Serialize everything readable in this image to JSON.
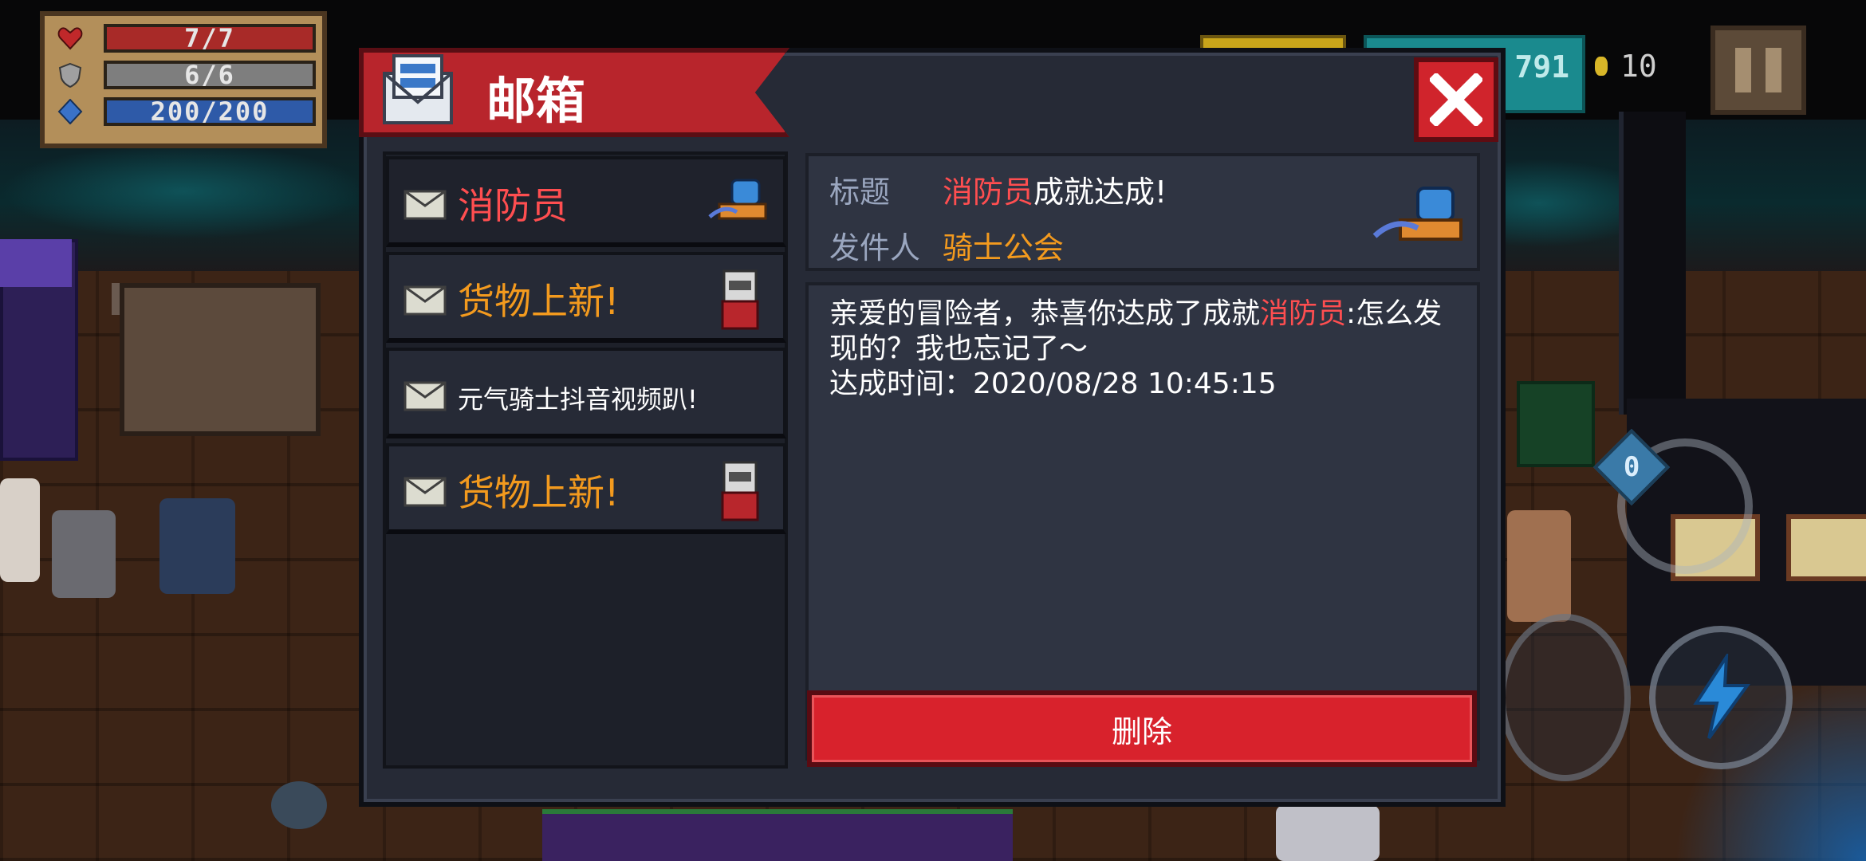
{
  "hud": {
    "hp": "7/7",
    "armor": "6/6",
    "energy": "200/200",
    "gems": "791",
    "coins": "10"
  },
  "dialog": {
    "title": "邮箱",
    "mails": [
      {
        "title": "消防员",
        "color": "#ff4e50",
        "thumb": "firefighter-sprite"
      },
      {
        "title": "货物上新!",
        "color": "#f39a1e",
        "thumb": "cat-merchant-sprite"
      },
      {
        "title": "元气骑士抖音视频趴!",
        "color": "#ffffff",
        "thumb": ""
      },
      {
        "title": "货物上新!",
        "color": "#f39a1e",
        "thumb": "cat-merchant-sprite"
      }
    ],
    "detail": {
      "subject_label": "标题",
      "subject_highlight": "消防员",
      "subject_rest": "成就达成!",
      "sender_label": "发件人",
      "sender": "骑士公会",
      "body_prefix": "亲爱的冒险者，恭喜你达成了成就",
      "body_highlight": "消防员",
      "body_suffix": ":怎么发现的？我也忘记了～",
      "body_time_label": "达成时间：",
      "body_time": "2020/08/28 10:45:15"
    },
    "delete_label": "删除"
  },
  "controls": {
    "weapon_swap_count": "0"
  },
  "colors": {
    "accent_red": "#d8222c",
    "highlight_red": "#ff4e50",
    "highlight_orange": "#f39a1e",
    "panel_bg": "#262a36"
  }
}
